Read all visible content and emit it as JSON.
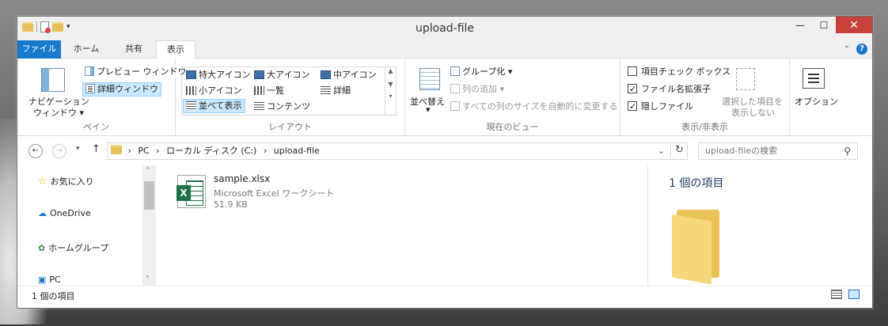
{
  "window": {
    "title": "upload-file",
    "controls": {
      "minimize": "—",
      "maximize": "☐",
      "close": "✕"
    }
  },
  "qat": {
    "dropdown": "▾"
  },
  "tabs": [
    {
      "label": "ファイル"
    },
    {
      "label": "ホーム"
    },
    {
      "label": "共有"
    },
    {
      "label": "表示"
    }
  ],
  "ribbon": {
    "pane": {
      "label": "ペイン",
      "nav_pane_line1": "ナビゲーション",
      "nav_pane_line2": "ウィンドウ ▾",
      "preview": "プレビュー ウィンドウ",
      "details": "詳細ウィンドウ"
    },
    "layout": {
      "label": "レイアウト",
      "items": [
        "特大アイコン",
        "大アイコン",
        "中アイコン",
        "小アイコン",
        "一覧",
        "詳細",
        "並べて表示",
        "コンテンツ"
      ],
      "scroll_up": "▲",
      "scroll_down": "▼",
      "scroll_more": "▾"
    },
    "current_view": {
      "label": "現在のビュー",
      "sort_line1": "並べ替え",
      "sort_line2": "▾",
      "group": "グループ化 ▾",
      "add_column": "列の追加 ▾",
      "fit_columns": "すべての列のサイズを自動的に変更する"
    },
    "show_hide": {
      "label": "表示/非表示",
      "item_checkbox": "項目チェック ボックス",
      "extensions": "ファイル名拡張子",
      "hidden": "隠しファイル",
      "hide_sel_line1": "選択した項目を",
      "hide_sel_line2": "表示しない"
    },
    "options": {
      "label": "オプション"
    }
  },
  "address": {
    "back": "←",
    "forward": "→",
    "recent": "▾",
    "up": "↑",
    "path": [
      "PC",
      "ローカル ディスク (C:)",
      "upload-file"
    ],
    "sep": "›",
    "dropdown": "⌄",
    "refresh": "↻",
    "search_placeholder": "upload-fileの検索",
    "search_icon": "⚲"
  },
  "nav": {
    "items": [
      "お気に入り",
      "OneDrive",
      "ホームグループ",
      "PC"
    ],
    "scroll_up": "˄",
    "scroll_down": "˅"
  },
  "files": [
    {
      "name": "sample.xlsx",
      "type": "Microsoft Excel ワークシート",
      "size": "51.9 KB",
      "icon_letter": "X"
    }
  ],
  "preview": {
    "count": "1 個の項目"
  },
  "status": {
    "text": "1 個の項目"
  },
  "colors": {
    "file_tab": "#1979ca",
    "close": "#c7413b",
    "excel": "#1e7145",
    "folder": "#f6d77c"
  }
}
